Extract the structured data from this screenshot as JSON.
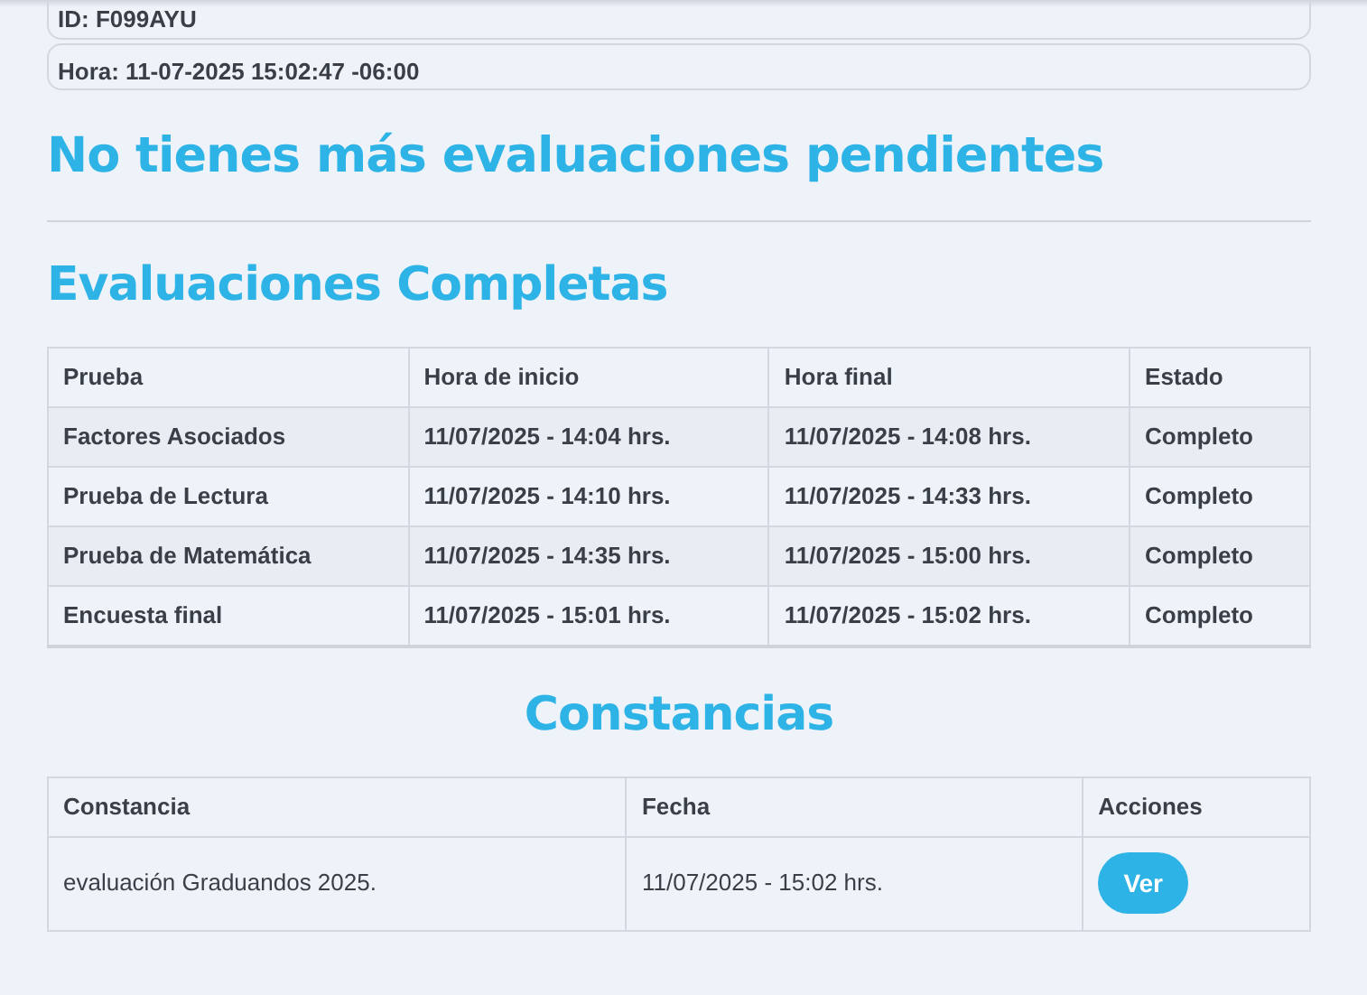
{
  "info": [
    "ID: F099AYU",
    "Hora: 11-07-2025 15:02:47 -06:00"
  ],
  "pending_title": "No tienes más evaluaciones pendientes",
  "completed": {
    "title": "Evaluaciones Completas",
    "columns": [
      "Prueba",
      "Hora de inicio",
      "Hora final",
      "Estado"
    ],
    "rows": [
      [
        "Factores Asociados",
        "11/07/2025 - 14:04 hrs.",
        "11/07/2025 - 14:08 hrs.",
        "Completo"
      ],
      [
        "Prueba de Lectura",
        "11/07/2025 - 14:10 hrs.",
        "11/07/2025 - 14:33 hrs.",
        "Completo"
      ],
      [
        "Prueba de Matemática",
        "11/07/2025 - 14:35 hrs.",
        "11/07/2025 - 15:00 hrs.",
        "Completo"
      ],
      [
        "Encuesta final",
        "11/07/2025 - 15:01 hrs.",
        "11/07/2025 - 15:02 hrs.",
        "Completo"
      ]
    ]
  },
  "certificates": {
    "title": "Constancias",
    "columns": [
      "Constancia",
      "Fecha",
      "Acciones"
    ],
    "rows": [
      {
        "name": "evaluación Graduandos 2025.",
        "date": "11/07/2025 - 15:02 hrs.",
        "action": "Ver"
      }
    ]
  }
}
